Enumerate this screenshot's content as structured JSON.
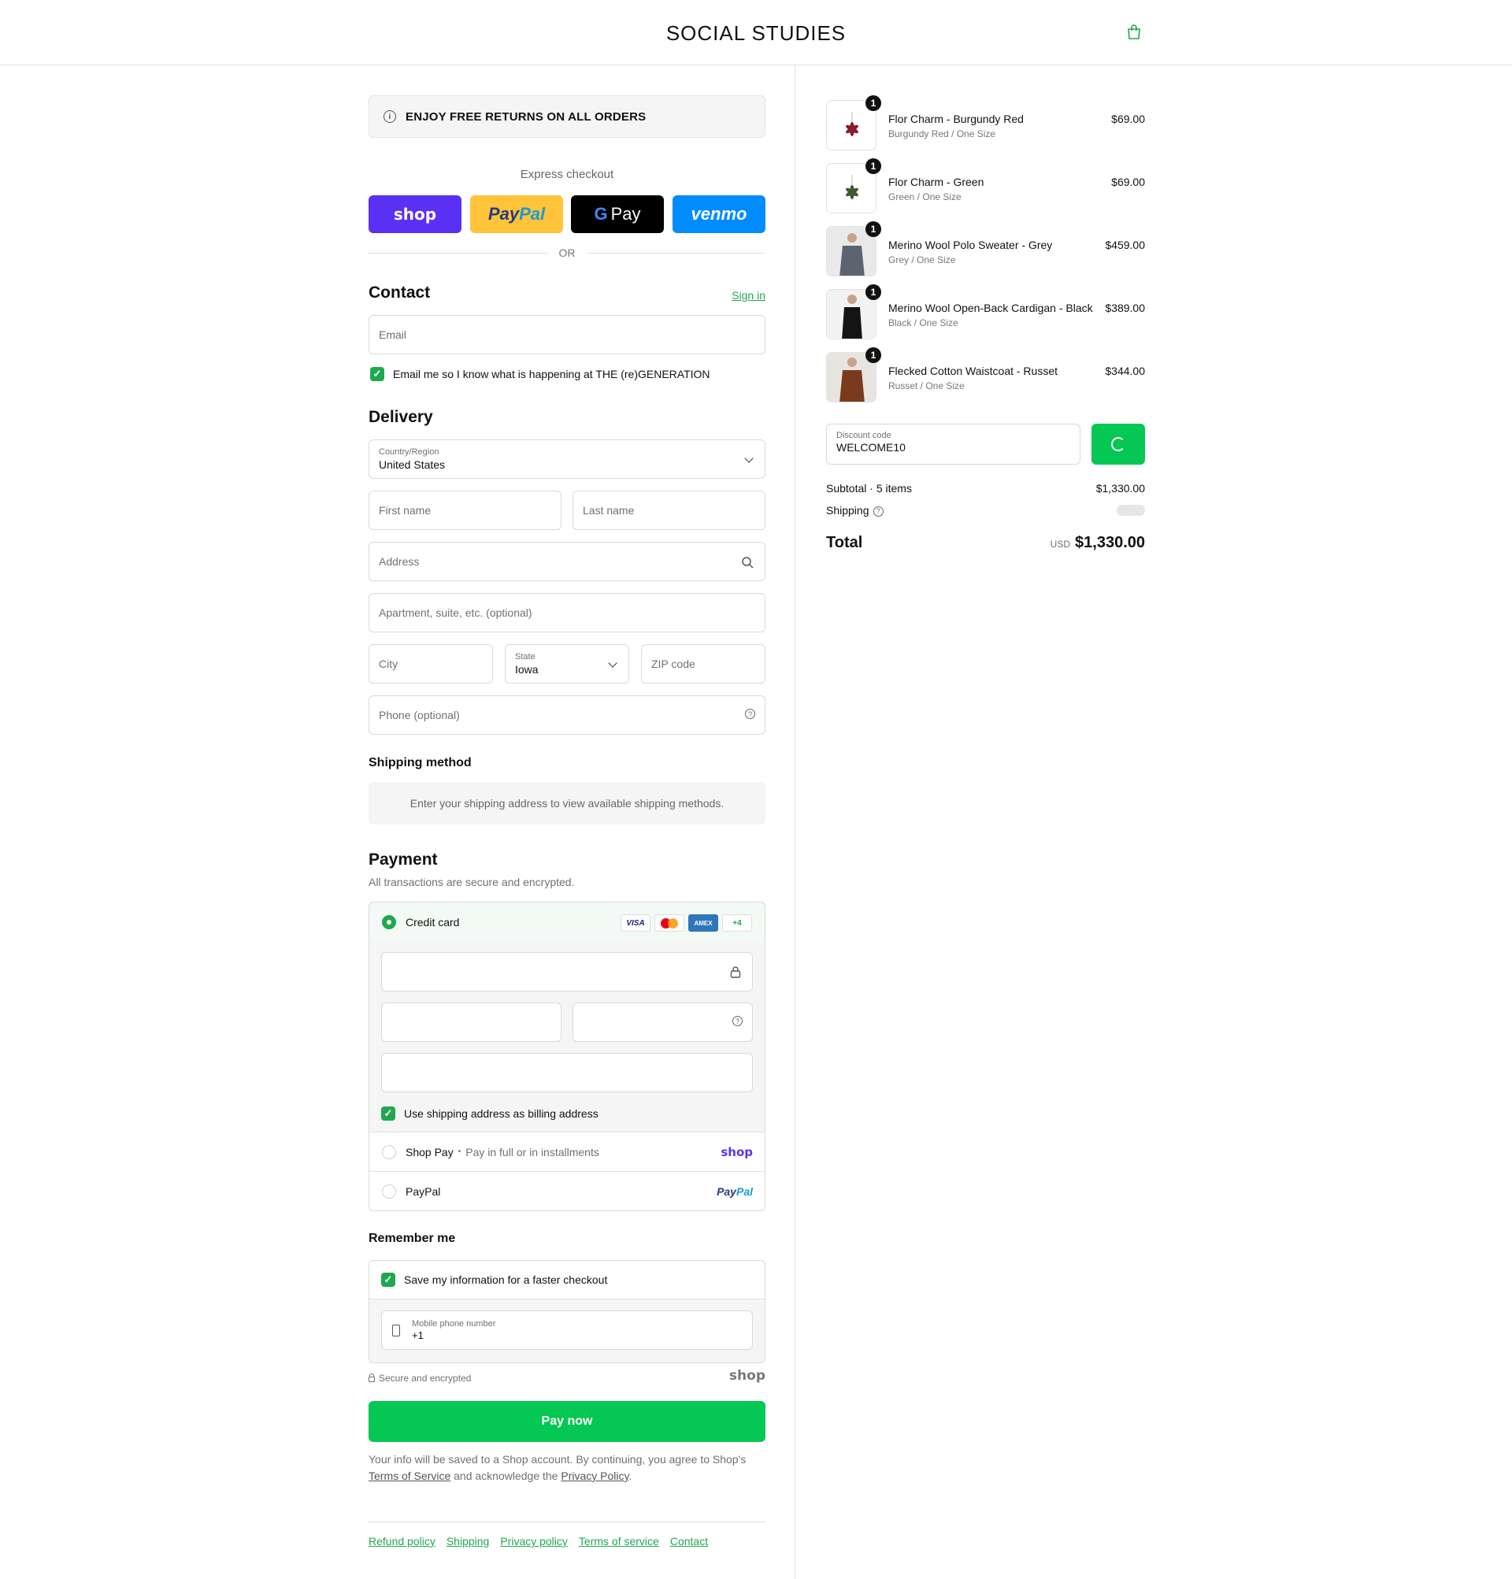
{
  "header": {
    "brand": "SOCIAL STUDIES",
    "cart_icon": "shopping-bag-icon"
  },
  "colors": {
    "accent": "#1fa84f",
    "pay_button": "#05c753",
    "shop_purple": "#5a31f4",
    "paypal_yellow": "#ffc439",
    "venmo_blue": "#008cff"
  },
  "banner": {
    "text": "ENJOY FREE RETURNS ON ALL ORDERS",
    "icon": "info-icon"
  },
  "express": {
    "label": "Express checkout",
    "buttons": {
      "shop": "shop",
      "paypal_a": "Pay",
      "paypal_b": "Pal",
      "gpay_g": "G",
      "gpay": "Pay",
      "venmo": "venmo"
    },
    "or": "OR"
  },
  "contact": {
    "title": "Contact",
    "sign_in": "Sign in",
    "email_placeholder": "Email",
    "newsletter_label": "Email me so I know what is happening at THE (re)GENERATION",
    "newsletter_checked": true
  },
  "delivery": {
    "title": "Delivery",
    "country_label": "Country/Region",
    "country_value": "United States",
    "first_name": "First name",
    "last_name": "Last name",
    "address": "Address",
    "apartment": "Apartment, suite, etc. (optional)",
    "city": "City",
    "state_label": "State",
    "state_value": "Iowa",
    "zip": "ZIP code",
    "phone": "Phone (optional)"
  },
  "shipping_method": {
    "title": "Shipping method",
    "notice": "Enter your shipping address to view available shipping methods."
  },
  "payment": {
    "title": "Payment",
    "subtitle": "All transactions are secure and encrypted.",
    "credit_card": "Credit card",
    "card_brands": {
      "visa": "VISA",
      "amex": "AMEX",
      "more": "+4"
    },
    "billing_same": "Use shipping address as billing address",
    "shop_pay": "Shop Pay",
    "shop_pay_dot": "•",
    "shop_pay_sub": "Pay in full or in installments",
    "shop_logo": "shop",
    "paypal": "PayPal",
    "paypal_logo_a": "Pay",
    "paypal_logo_b": "Pal"
  },
  "remember": {
    "title": "Remember me",
    "save_label": "Save my information for a faster checkout",
    "phone_label": "Mobile phone number",
    "phone_value": "+1"
  },
  "secure": {
    "text": "Secure and encrypted",
    "shop": "shop"
  },
  "pay_now": "Pay now",
  "legal": {
    "text_a": "Your info will be saved to a Shop account. By continuing, you agree to Shop's",
    "terms": "Terms of Service",
    "text_b": "and acknowledge the",
    "privacy": "Privacy Policy",
    "end": "."
  },
  "footer": [
    "Refund policy",
    "Shipping",
    "Privacy policy",
    "Terms of service",
    "Contact"
  ],
  "order": {
    "items": [
      {
        "name": "Flor Charm - Burgundy Red",
        "variant": "Burgundy Red / One Size",
        "price": "$69.00",
        "qty": "1",
        "color": "#8b1a2b"
      },
      {
        "name": "Flor Charm - Green",
        "variant": "Green / One Size",
        "price": "$69.00",
        "qty": "1",
        "color": "#3e5a2c"
      },
      {
        "name": "Merino Wool Polo Sweater - Grey",
        "variant": "Grey / One Size",
        "price": "$459.00",
        "qty": "1",
        "color": "#5b6470"
      },
      {
        "name": "Merino Wool Open-Back Cardigan - Black",
        "variant": "Black / One Size",
        "price": "$389.00",
        "qty": "1",
        "color": "#141414"
      },
      {
        "name": "Flecked Cotton Waistcoat - Russet",
        "variant": "Russet / One Size",
        "price": "$344.00",
        "qty": "1",
        "color": "#7a3a1e"
      }
    ],
    "discount_label": "Discount code",
    "discount_value": "WELCOME10",
    "subtotal_label": "Subtotal · 5 items",
    "subtotal_value": "$1,330.00",
    "shipping_label": "Shipping",
    "total_label": "Total",
    "currency": "USD",
    "total_value": "$1,330.00"
  }
}
